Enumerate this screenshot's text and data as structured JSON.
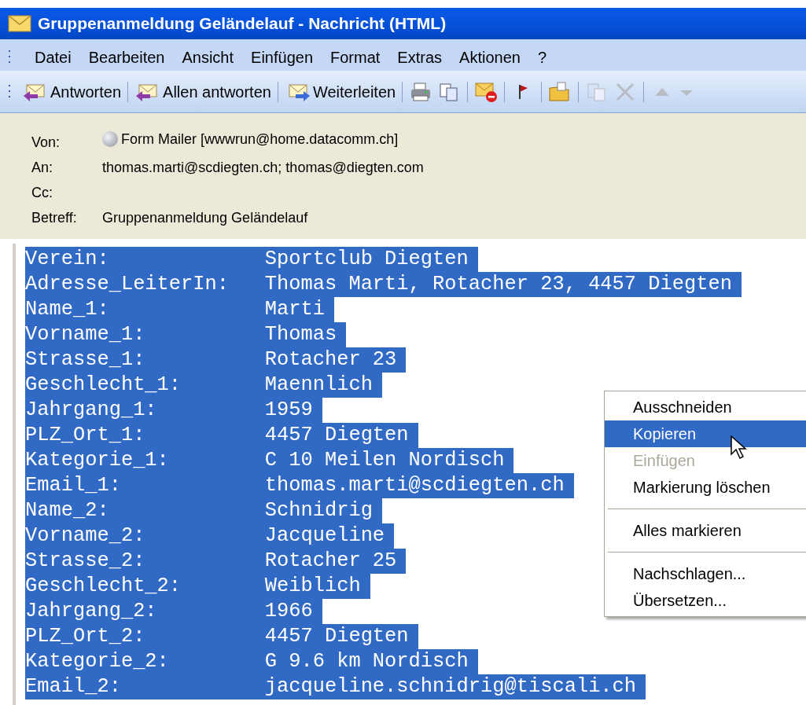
{
  "window": {
    "title": "Gruppenanmeldung Geländelauf - Nachricht (HTML)"
  },
  "menu": [
    {
      "label": "Datei"
    },
    {
      "label": "Bearbeiten"
    },
    {
      "label": "Ansicht"
    },
    {
      "label": "Einfügen"
    },
    {
      "label": "Format"
    },
    {
      "label": "Extras"
    },
    {
      "label": "Aktionen"
    },
    {
      "label": "?"
    }
  ],
  "toolbar": [
    {
      "kind": "reply",
      "label": "Antworten"
    },
    {
      "kind": "reply_all",
      "label": "Allen antworten"
    },
    {
      "kind": "forward",
      "label": "Weiterleiten"
    },
    {
      "kind": "print",
      "disabled": false
    },
    {
      "kind": "copy",
      "disabled": false
    },
    {
      "kind": "junk",
      "disabled": false
    },
    {
      "kind": "flag",
      "disabled": false
    },
    {
      "kind": "move",
      "disabled": false
    },
    {
      "kind": "paste",
      "disabled": true
    },
    {
      "kind": "delete",
      "disabled": true
    },
    {
      "kind": "up",
      "disabled": true
    },
    {
      "kind": "down",
      "disabled": true
    }
  ],
  "header": [
    {
      "kind": "sender",
      "label": "Von:",
      "value": "Form Mailer [wwwrun@home.datacomm.ch]"
    },
    {
      "kind": "field",
      "label": "An:",
      "value": "thomas.marti@scdiegten.ch; thomas@diegten.com"
    },
    {
      "kind": "field",
      "label": "Cc:"
    },
    {
      "kind": "field",
      "label": "Betreff:",
      "value": "Gruppenanmeldung Geländelauf"
    }
  ],
  "body": [
    {
      "key": "Verein:",
      "value": "Sportclub Diegten"
    },
    {
      "key": "Adresse_LeiterIn:",
      "value": "Thomas Marti, Rotacher 23, 4457 Diegten"
    },
    {
      "key": "Name_1:",
      "value": "Marti"
    },
    {
      "key": "Vorname_1:",
      "value": "Thomas"
    },
    {
      "key": "Strasse_1:",
      "value": "Rotacher 23"
    },
    {
      "key": "Geschlecht_1:",
      "value": "Maennlich"
    },
    {
      "key": "Jahrgang_1:",
      "value": "1959"
    },
    {
      "key": "PLZ_Ort_1:",
      "value": "4457 Diegten"
    },
    {
      "key": "Kategorie_1:",
      "value": "C 10 Meilen Nordisch"
    },
    {
      "key": "Email_1:",
      "value": "thomas.marti@scdiegten.ch"
    },
    {
      "key": "Name_2:",
      "value": "Schnidrig"
    },
    {
      "key": "Vorname_2:",
      "value": "Jacqueline"
    },
    {
      "key": "Strasse_2:",
      "value": "Rotacher 25"
    },
    {
      "key": "Geschlecht_2:",
      "value": "Weiblich"
    },
    {
      "key": "Jahrgang_2:",
      "value": "1966"
    },
    {
      "key": "PLZ_Ort_2:",
      "value": "4457 Diegten"
    },
    {
      "key": "Kategorie_2:",
      "value": "G 9.6 km Nordisch"
    },
    {
      "key": "Email_2:",
      "value": "jacqueline.schnidrig@tiscali.ch"
    }
  ],
  "context_menu": [
    {
      "kind": "item",
      "label": "Ausschneiden",
      "selected": false,
      "disabled": false
    },
    {
      "kind": "item",
      "label": "Kopieren",
      "selected": true,
      "disabled": false
    },
    {
      "kind": "item",
      "label": "Einfügen",
      "selected": false,
      "disabled": true
    },
    {
      "kind": "item",
      "label": "Markierung löschen",
      "selected": false,
      "disabled": false
    },
    {
      "kind": "separator"
    },
    {
      "kind": "item",
      "label": "Alles markieren",
      "selected": false,
      "disabled": false
    },
    {
      "kind": "separator"
    },
    {
      "kind": "item",
      "label": "Nachschlagen...",
      "selected": false,
      "disabled": false
    },
    {
      "kind": "item",
      "label": "Übersetzen...",
      "selected": false,
      "disabled": false
    }
  ]
}
